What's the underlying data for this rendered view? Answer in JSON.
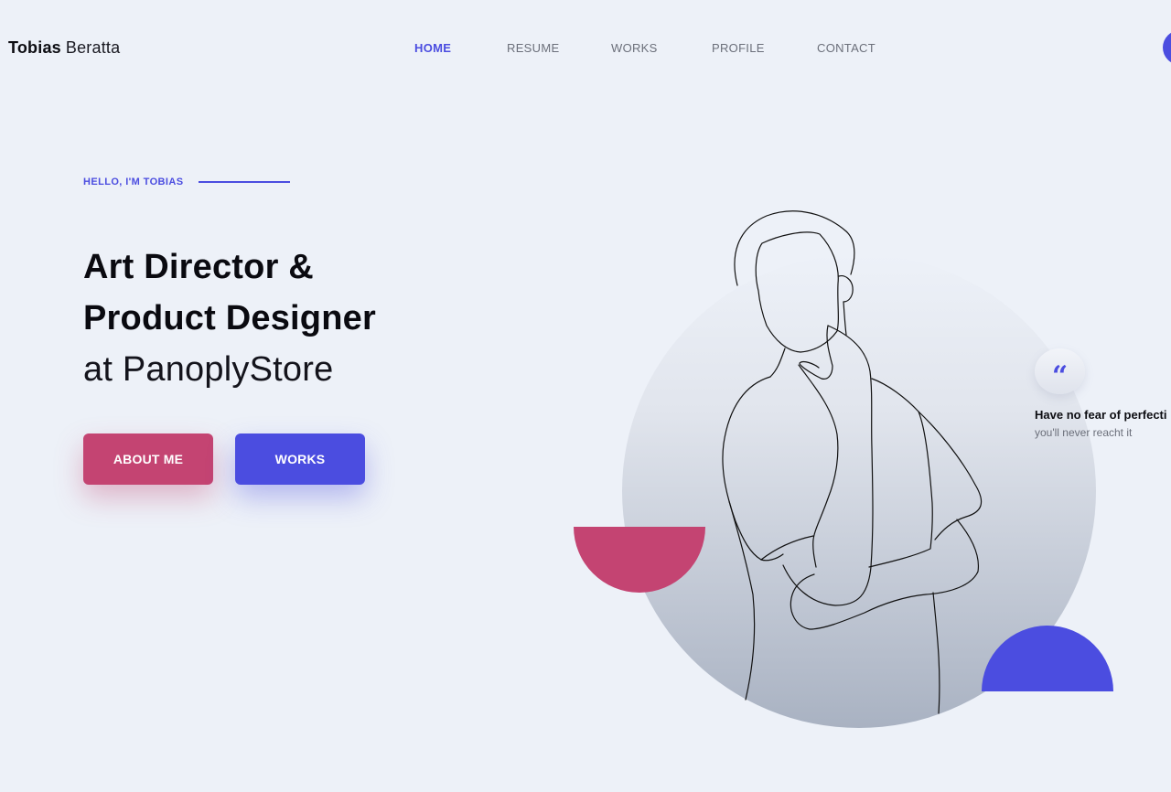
{
  "header": {
    "brand_first": "Tobias",
    "brand_last": "Beratta",
    "nav": [
      {
        "label": "HOME",
        "active": true
      },
      {
        "label": "RESUME",
        "active": false
      },
      {
        "label": "WORKS",
        "active": false
      },
      {
        "label": "PROFILE",
        "active": false
      },
      {
        "label": "CONTACT",
        "active": false
      }
    ]
  },
  "hero": {
    "eyebrow": "HELLO, I'M TOBIAS",
    "title_line1": "Art Director &",
    "title_line2": "Product Designer",
    "title_line3": "at PanoplyStore",
    "buttons": {
      "about": "ABOUT ME",
      "works": "WORKS"
    }
  },
  "quote": {
    "icon": "quote-icon",
    "mark": "“",
    "text": "Have no fear of perfecti",
    "subtext": "you'll never reacht it"
  },
  "colors": {
    "accent_blue": "#4b4de0",
    "accent_pink": "#c44472",
    "background": "#edf1f8"
  }
}
